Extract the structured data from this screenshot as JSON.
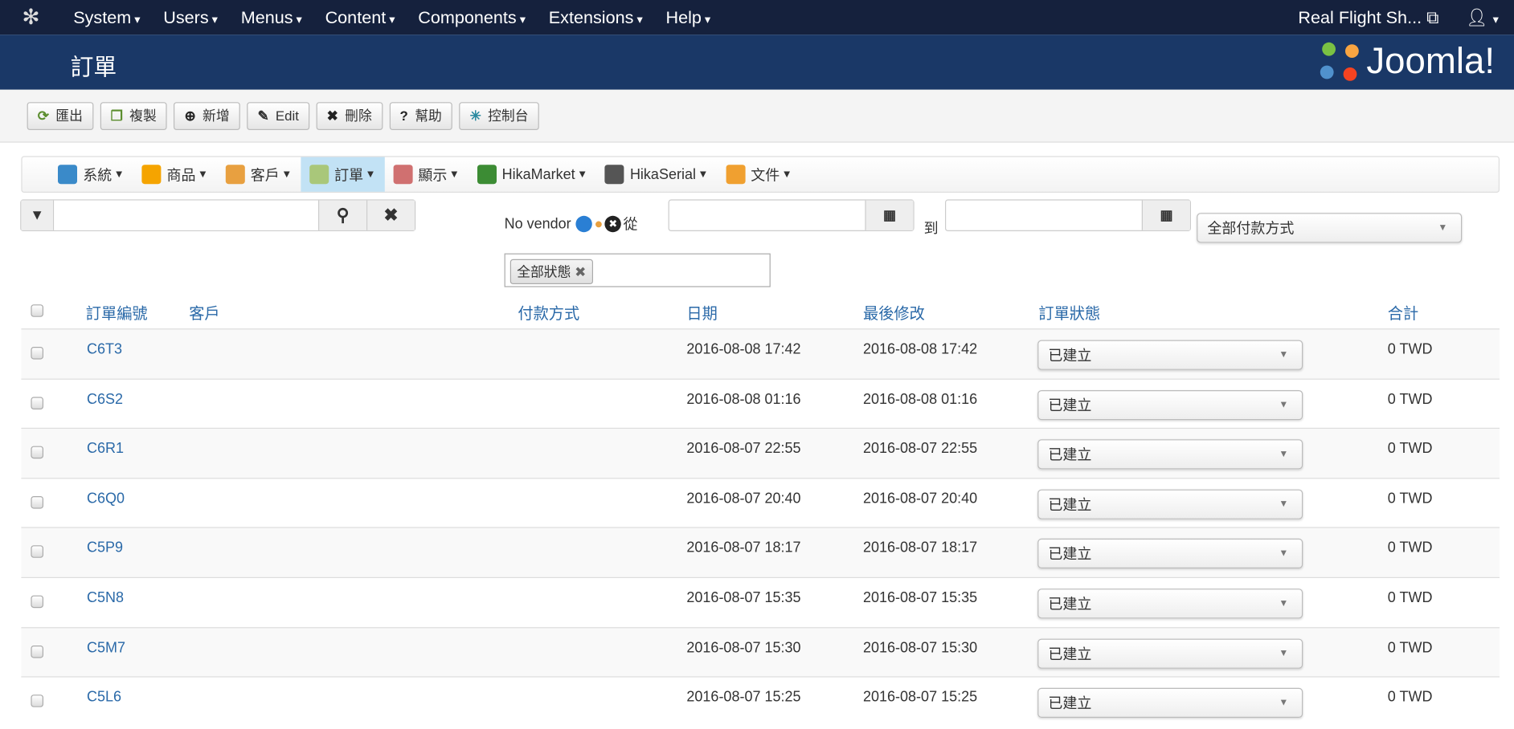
{
  "topnav": {
    "menus": [
      "System",
      "Users",
      "Menus",
      "Content",
      "Components",
      "Extensions",
      "Help"
    ],
    "site": "Real Flight Sh...",
    "user": "▾"
  },
  "header": {
    "title": "訂單",
    "logo": "Joomla!"
  },
  "toolbar": [
    {
      "icon": "export-icon",
      "g": "⟳",
      "label": "匯出",
      "c": "#5b8d2e"
    },
    {
      "icon": "copy-icon",
      "g": "❐",
      "label": "複製",
      "c": "#5b8d2e"
    },
    {
      "icon": "plus-icon",
      "g": "⊕",
      "label": "新增",
      "c": "#222"
    },
    {
      "icon": "edit-icon",
      "g": "✎",
      "label": "Edit",
      "c": "#333"
    },
    {
      "icon": "delete-icon",
      "g": "✖",
      "label": "刪除",
      "c": "#222"
    },
    {
      "icon": "help-icon",
      "g": "?",
      "label": "幫助",
      "c": "#222"
    },
    {
      "icon": "dashboard-icon",
      "g": "✳",
      "label": "控制台",
      "c": "#2a8aa0"
    }
  ],
  "hikamenu": [
    {
      "label": "系統",
      "c": "#3a8ac9"
    },
    {
      "label": "商品",
      "c": "#f5a400"
    },
    {
      "label": "客戶",
      "c": "#e8a040"
    },
    {
      "label": "訂單",
      "c": "#a9c77a",
      "active": true
    },
    {
      "label": "顯示",
      "c": "#d07070"
    },
    {
      "label": "HikaMarket",
      "c": "#3c8c34"
    },
    {
      "label": "HikaSerial",
      "c": "#555"
    },
    {
      "label": "文件",
      "c": "#f0a030"
    }
  ],
  "filters": {
    "search_value": "",
    "vendor": "No vendor",
    "from": "從",
    "to": "到",
    "payment": "全部付款方式",
    "status_tag": "全部狀態"
  },
  "columns": [
    "訂單編號",
    "客戶",
    "付款方式",
    "日期",
    "最後修改",
    "訂單狀態",
    "合計"
  ],
  "rows": [
    {
      "id": "C6T3",
      "date": "2016-08-08 17:42",
      "modified": "2016-08-08 17:42",
      "status": "已建立",
      "total": "0 TWD"
    },
    {
      "id": "C6S2",
      "date": "2016-08-08 01:16",
      "modified": "2016-08-08 01:16",
      "status": "已建立",
      "total": "0 TWD"
    },
    {
      "id": "C6R1",
      "date": "2016-08-07 22:55",
      "modified": "2016-08-07 22:55",
      "status": "已建立",
      "total": "0 TWD"
    },
    {
      "id": "C6Q0",
      "date": "2016-08-07 20:40",
      "modified": "2016-08-07 20:40",
      "status": "已建立",
      "total": "0 TWD"
    },
    {
      "id": "C5P9",
      "date": "2016-08-07 18:17",
      "modified": "2016-08-07 18:17",
      "status": "已建立",
      "total": "0 TWD"
    },
    {
      "id": "C5N8",
      "date": "2016-08-07 15:35",
      "modified": "2016-08-07 15:35",
      "status": "已建立",
      "total": "0 TWD"
    },
    {
      "id": "C5M7",
      "date": "2016-08-07 15:30",
      "modified": "2016-08-07 15:30",
      "status": "已建立",
      "total": "0 TWD"
    },
    {
      "id": "C5L6",
      "date": "2016-08-07 15:25",
      "modified": "2016-08-07 15:25",
      "status": "已建立",
      "total": "0 TWD"
    }
  ]
}
